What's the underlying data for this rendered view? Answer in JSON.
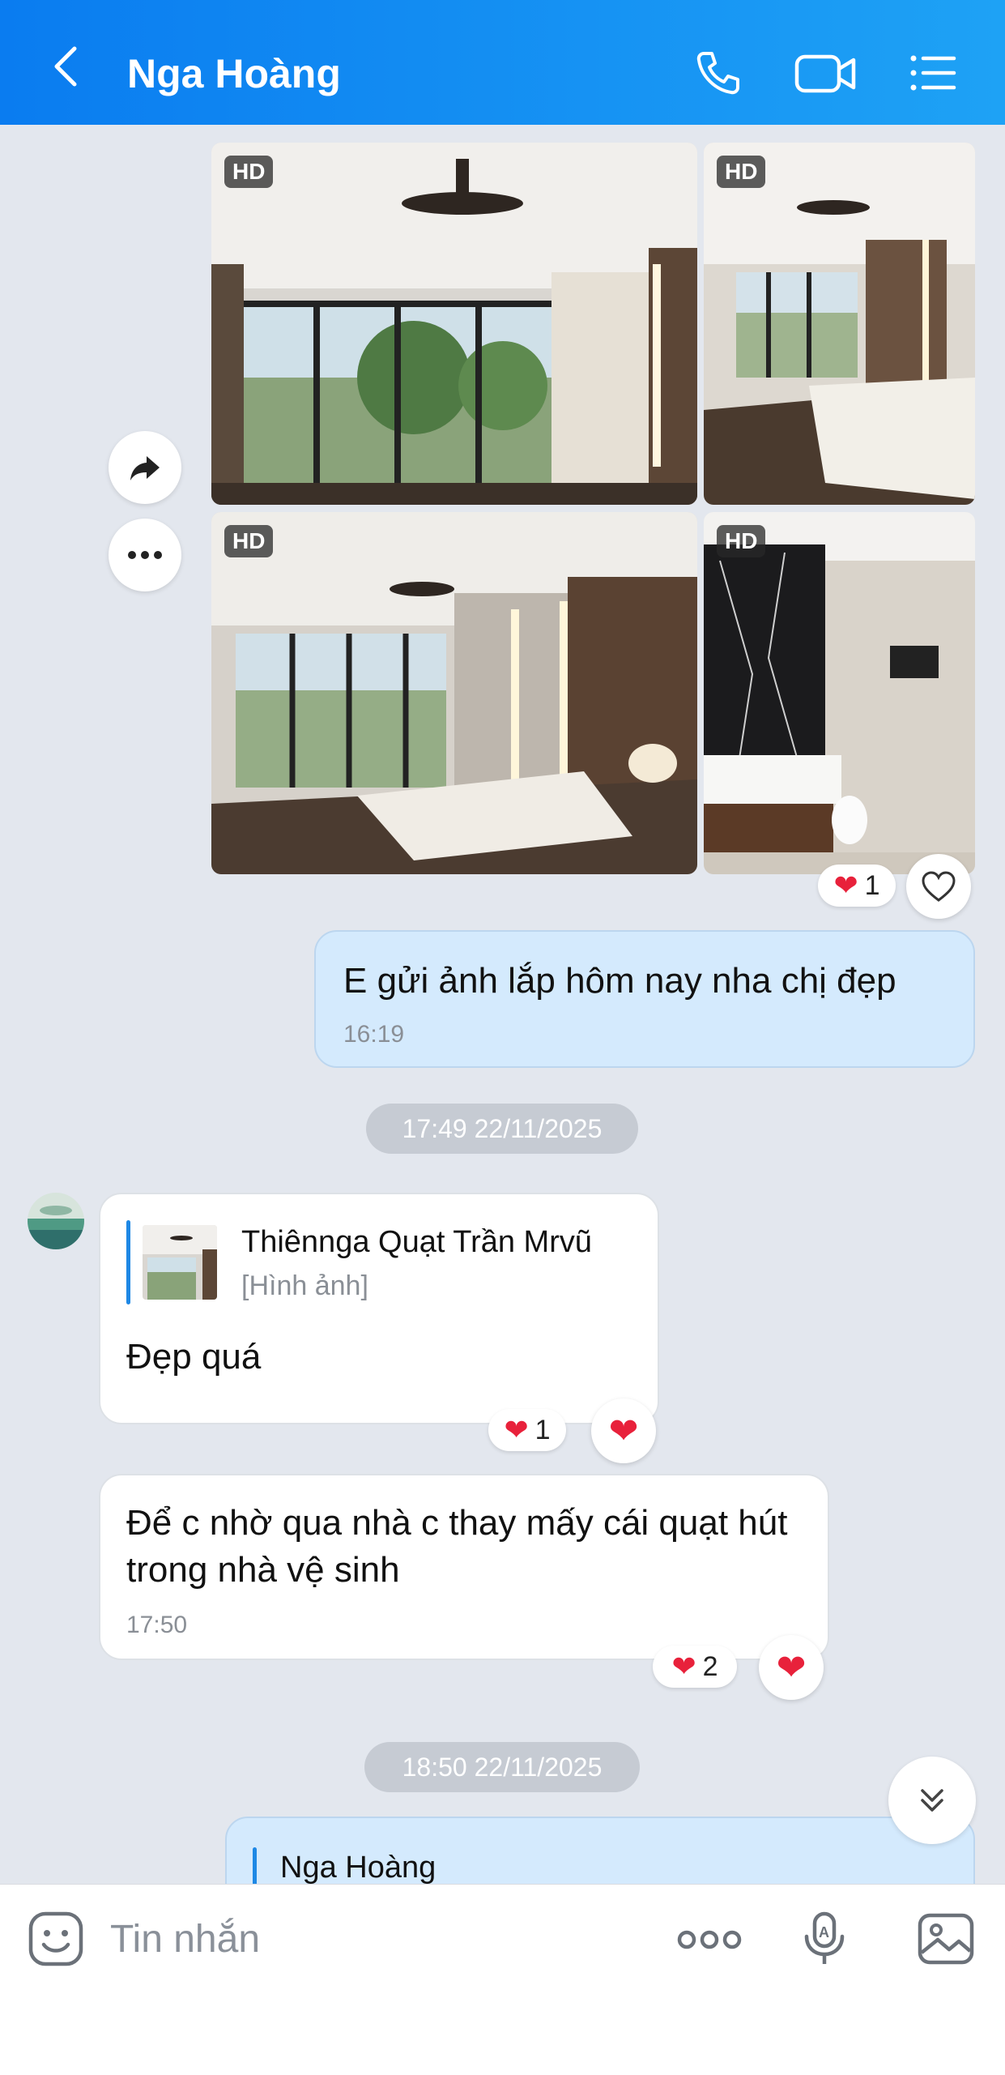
{
  "header": {
    "title": "Nga Hoàng",
    "icons": [
      "back-icon",
      "phone-icon",
      "video-icon",
      "list-icon"
    ],
    "accent": "#0a7cf0"
  },
  "photos": {
    "badge": "HD",
    "items": [
      "bedroom-window-view",
      "bedroom-side-view",
      "bedroom-bed-view",
      "bathroom-view"
    ],
    "reaction_count": "1"
  },
  "messages": [
    {
      "sender": "me",
      "text": "E gửi ảnh lắp hôm nay nha chị đẹp",
      "time": "16:19"
    },
    {
      "divider": "17:49 22/11/2025"
    },
    {
      "sender": "Thiênnga Quạt Trần Mrvũ",
      "quote_name": "Thiênnga Quạt Trần Mrvũ",
      "quote_text": "[Hình ảnh]",
      "text": "Đẹp quá",
      "reaction_count": "1"
    },
    {
      "sender": "Thiênnga Quạt Trần Mrvũ",
      "text": "Để c nhờ qua nhà c thay mấy cái quạt hút trong nhà vệ sinh",
      "time": "17:50",
      "reaction_count": "2"
    },
    {
      "divider": "18:50 22/11/2025"
    },
    {
      "sender": "me",
      "quote_name": "Nga Hoàng"
    }
  ],
  "input": {
    "placeholder": "Tin nhắn",
    "icons": [
      "sticker-icon",
      "more-icon",
      "voice-icon",
      "image-icon"
    ]
  }
}
